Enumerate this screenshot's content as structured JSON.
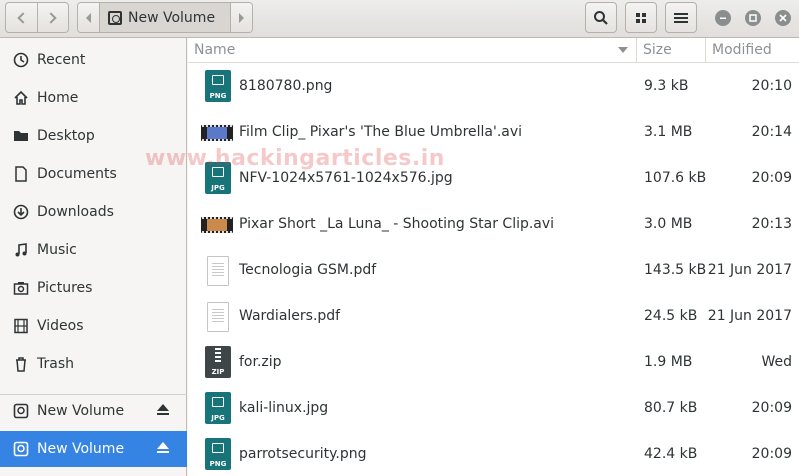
{
  "header": {
    "location_label": "New Volume"
  },
  "sidebar": {
    "items": [
      {
        "label": "Recent",
        "icon": "clock-icon"
      },
      {
        "label": "Home",
        "icon": "home-icon"
      },
      {
        "label": "Desktop",
        "icon": "folder-icon"
      },
      {
        "label": "Documents",
        "icon": "document-icon"
      },
      {
        "label": "Downloads",
        "icon": "download-icon"
      },
      {
        "label": "Music",
        "icon": "music-icon"
      },
      {
        "label": "Pictures",
        "icon": "camera-icon"
      },
      {
        "label": "Videos",
        "icon": "film-icon"
      },
      {
        "label": "Trash",
        "icon": "trash-icon"
      }
    ],
    "volumes": [
      {
        "label": "New Volume",
        "icon": "drive-icon",
        "active": false
      },
      {
        "label": "New Volume",
        "icon": "drive-icon",
        "active": true
      }
    ]
  },
  "columns": {
    "name": "Name",
    "size": "Size",
    "modified": "Modified"
  },
  "files": [
    {
      "name": "8180780.png",
      "size": "9.3 kB",
      "modified": "20:10",
      "type": "image",
      "ext": "PNG"
    },
    {
      "name": "Film Clip_ Pixar's 'The Blue Umbrella'.avi",
      "size": "3.1 MB",
      "modified": "20:14",
      "type": "video"
    },
    {
      "name": "NFV-1024x5761-1024x576.jpg",
      "size": "107.6 kB",
      "modified": "20:09",
      "type": "image",
      "ext": "JPG"
    },
    {
      "name": "Pixar Short _La Luna_ - Shooting Star Clip.avi",
      "size": "3.0 MB",
      "modified": "20:13",
      "type": "video"
    },
    {
      "name": "Tecnologia GSM.pdf",
      "size": "143.5 kB",
      "modified": "21 Jun 2017",
      "type": "pdf"
    },
    {
      "name": "Wardialers.pdf",
      "size": "24.5 kB",
      "modified": "21 Jun 2017",
      "type": "pdf"
    },
    {
      "name": "for.zip",
      "size": "1.9 MB",
      "modified": "Wed",
      "type": "zip",
      "ext": "ZIP"
    },
    {
      "name": "kali-linux.jpg",
      "size": "80.7 kB",
      "modified": "20:09",
      "type": "image",
      "ext": "JPG"
    },
    {
      "name": "parrotsecurity.png",
      "size": "42.4 kB",
      "modified": "20:09",
      "type": "image",
      "ext": "PNG"
    }
  ],
  "watermark": "www.hackingarticles.in",
  "colors": {
    "accent": "#3584e4",
    "file_icon_teal": "#17757a"
  }
}
